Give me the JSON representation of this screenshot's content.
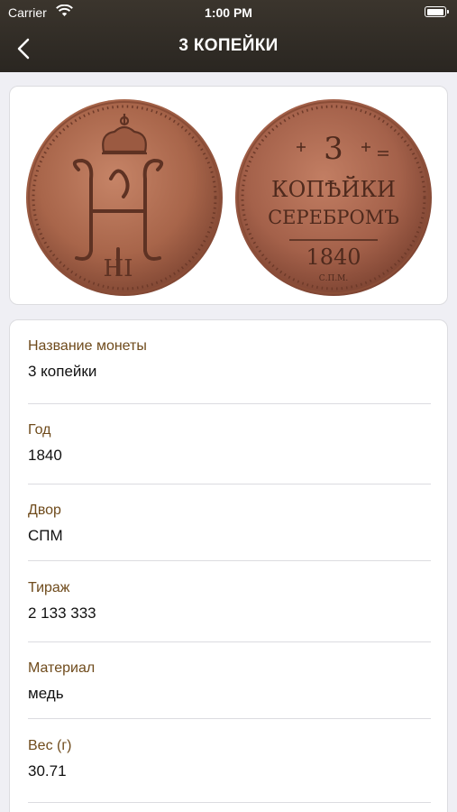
{
  "status_bar": {
    "carrier": "Carrier",
    "time": "1:00 PM",
    "battery_level": 0.95
  },
  "nav": {
    "title": "3 КОПЕЙКИ",
    "back_icon": "chevron-left-icon"
  },
  "coin_images": {
    "obverse": {
      "monogram": "НІ"
    },
    "reverse": {
      "lines": [
        "3",
        "КОПѢЙКИ",
        "СЕРЕБРОМЪ",
        "1840",
        "С.П.М."
      ]
    }
  },
  "details": [
    {
      "label": "Название монеты",
      "value": "3 копейки"
    },
    {
      "label": "Год",
      "value": "1840"
    },
    {
      "label": "Двор",
      "value": "СПМ"
    },
    {
      "label": "Тираж",
      "value": "2 133 333"
    },
    {
      "label": "Материал",
      "value": "медь"
    },
    {
      "label": "Вес (г)",
      "value": "30.71"
    }
  ],
  "colors": {
    "bar": "#2f2a24",
    "label": "#6f4b1c",
    "copper": "#a8654a"
  }
}
